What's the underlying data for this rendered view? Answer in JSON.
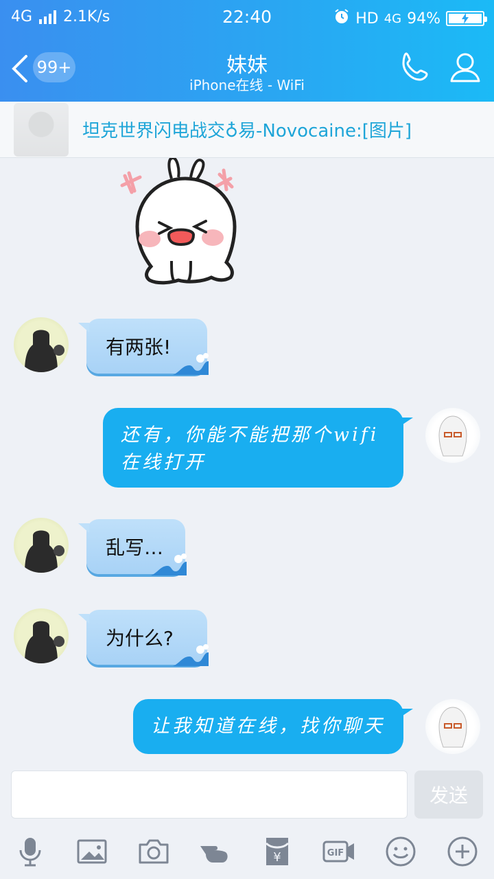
{
  "status_bar": {
    "network": "4G",
    "speed": "2.1K/s",
    "time": "22:40",
    "hd": "HD",
    "network_right": "4G",
    "battery": "94%"
  },
  "header": {
    "back_badge": "99+",
    "title": "妹妹",
    "subtitle": "iPhone在线 - WiFi"
  },
  "notice": {
    "text": "坦克世界闪电战交♁易-Novocaine:[图片]"
  },
  "messages": [
    {
      "side": "in",
      "text": "有两张!"
    },
    {
      "side": "out",
      "text": "还有，你能不能把那个wifi在线打开"
    },
    {
      "side": "in",
      "text": "乱写…"
    },
    {
      "side": "in",
      "text": "为什么?"
    },
    {
      "side": "out",
      "text": "让我知道在线，找你聊天"
    }
  ],
  "input": {
    "placeholder": "",
    "send_label": "发送"
  },
  "toolbar": {
    "icons": [
      "microphone-icon",
      "image-icon",
      "camera-icon",
      "poke-icon",
      "red-packet-icon",
      "gif-icon",
      "emoji-icon",
      "plus-icon"
    ]
  },
  "colors": {
    "header_start": "#3a8ff0",
    "header_end": "#1bbaf6",
    "outgoing_bubble": "#19aef0",
    "incoming_bubble": "#bfe0fa",
    "notice_text": "#1ea5d8",
    "background": "#eef1f6"
  }
}
